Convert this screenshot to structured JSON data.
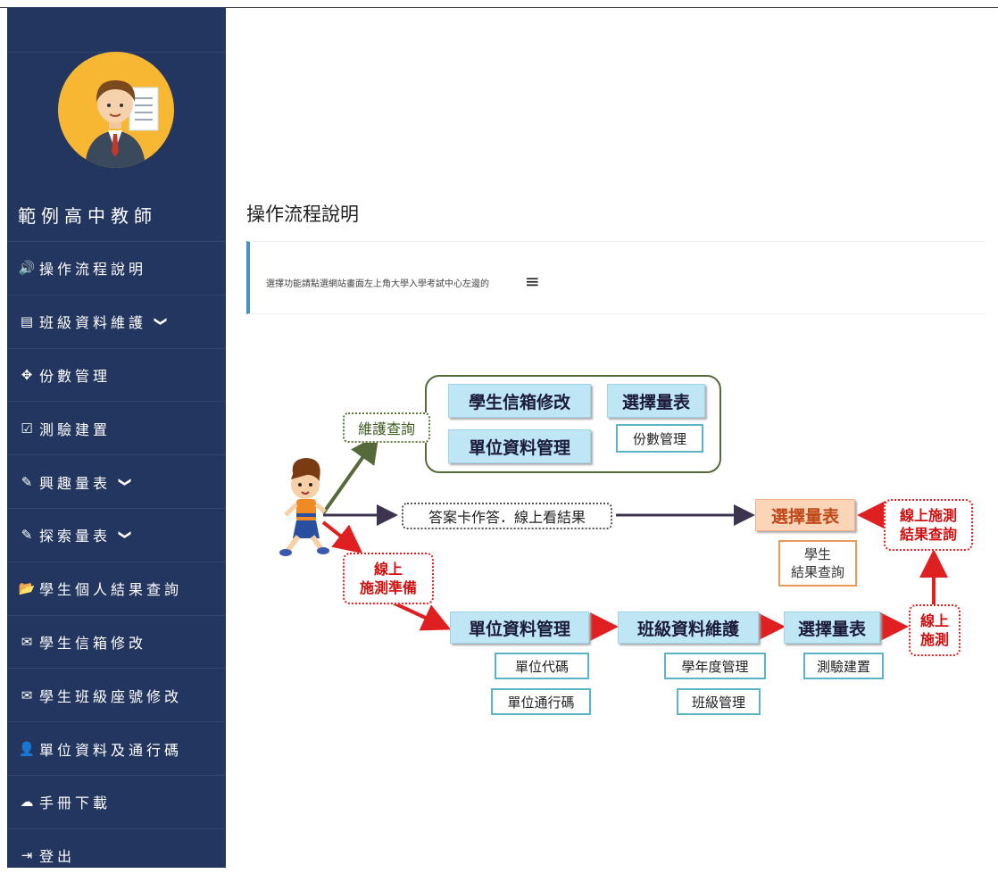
{
  "sidebar": {
    "user_name": "範例高中教師",
    "menu": [
      {
        "icon": "volume-icon",
        "glyph": "🔊",
        "label": "操作流程說明"
      },
      {
        "icon": "list-icon",
        "glyph": "▤",
        "label": "班級資料維護",
        "chevron": true
      },
      {
        "icon": "move-icon",
        "glyph": "✥",
        "label": "份數管理"
      },
      {
        "icon": "checkbox-icon",
        "glyph": "☑",
        "label": "測驗建置"
      },
      {
        "icon": "pencil-icon",
        "glyph": "✎",
        "label": "興趣量表",
        "chevron": true
      },
      {
        "icon": "pencil-icon",
        "glyph": "✎",
        "label": "探索量表",
        "chevron": true
      },
      {
        "icon": "folder-icon",
        "glyph": "📂",
        "label": "學生個人結果查詢"
      },
      {
        "icon": "envelope-icon",
        "glyph": "✉",
        "label": "學生信箱修改"
      },
      {
        "icon": "envelope-icon",
        "glyph": "✉",
        "label": "學生班級座號修改"
      },
      {
        "icon": "user-icon",
        "glyph": "👤",
        "label": "單位資料及通行碼"
      },
      {
        "icon": "cloud-download-icon",
        "glyph": "☁",
        "label": "手冊下載"
      },
      {
        "icon": "logout-icon",
        "glyph": "⇥",
        "label": "登出"
      }
    ],
    "chevron_glyph": "❯"
  },
  "main": {
    "title": "操作流程說明",
    "notice": "選擇功能請點選網站畫面左上角大學入學考試中心左邊的",
    "hamburger_glyph": "≡"
  },
  "diagram": {
    "maintain_query": "維護查詢",
    "student_email": "學生信箱修改",
    "select_scale_top": "選擇量表",
    "unit_data_top": "單位資料管理",
    "copies_mgmt": "份數管理",
    "answer_card": "答案卡作答．線上看結果",
    "select_scale_mid": "選擇量表",
    "online_result_query": "線上施測\n結果查詢",
    "student_result_query": "學生\n結果查詢",
    "online_prep": "線上\n施測準備",
    "unit_data_bottom": "單位資料管理",
    "class_data": "班級資料維護",
    "select_scale_bottom": "選擇量表",
    "online_test": "線上\n施測",
    "unit_code": "單位代碼",
    "unit_pass": "單位通行碼",
    "year_mgmt": "學年度管理",
    "class_mgmt": "班級管理",
    "test_setup": "測驗建置"
  },
  "colors": {
    "sidebar_bg": "#22365f",
    "avatar_bg": "#f7b733",
    "notice_accent": "#4a90c8",
    "arrow_red": "#e02020",
    "arrow_green": "#55693a",
    "arrow_dark": "#3d3550"
  }
}
